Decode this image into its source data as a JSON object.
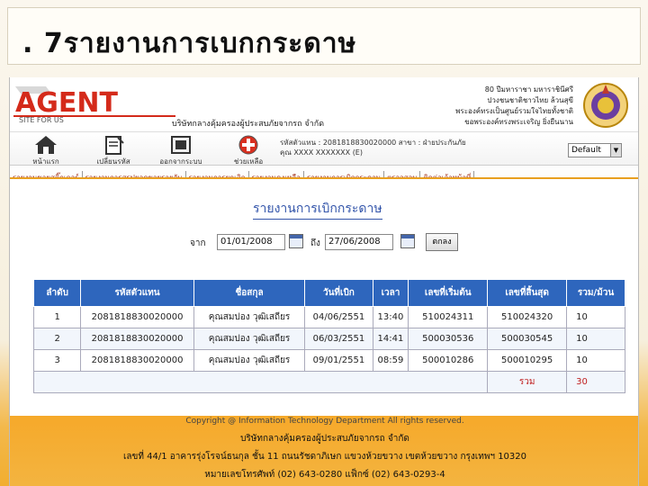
{
  "slide": {
    "title": ". 7รายงานการเบกกระดาษ"
  },
  "header": {
    "logo_text": "AGENT",
    "logo_subtext": "SITE FOR US",
    "company_name": "บริษัทกลางคุ้มครองผู้ประสบภัยจากรถ จำกัด",
    "royal_text": [
      "80 ปีมหาราชา มหาราชินีศรี",
      "ปวงชนชาติชาวไทย ล้วนสุขี",
      "พระองค์ทรงเป็นศูนย์รวมใจไทยทั้งชาติ",
      "ขอพระองค์ทรงพระเจริญ ยิ่งยืนนาน"
    ]
  },
  "toolbar": {
    "items": [
      {
        "label": "หน้าแรก",
        "icon": "home-icon"
      },
      {
        "label": "เปลี่ยนรหัส",
        "icon": "edit-icon"
      },
      {
        "label": "ออกจากระบบ",
        "icon": "logout-icon"
      },
      {
        "label": "ช่วยเหลือ",
        "icon": "help-icon"
      }
    ],
    "user_info": [
      "รหัสตัวแทน : 2081818830020000 สาขา : ฝ่ายประกันภัย",
      "คุณ XXXX XXXXXXX (E)"
    ],
    "style_select": "Default"
  },
  "nav": {
    "items": [
      "รายงานขายสติ๊กเกอร์",
      "รายงานการสรุปยอดขายรายวัน",
      "รายงานการยกเลิก",
      "รายงานคงเหลือ",
      "รายงานการเบิกกระดาษ",
      "ตรวจสอบ",
      "ติดต่อเจ้าหน้าที่"
    ]
  },
  "report": {
    "title": "รายงานการเบิกกระดาษ",
    "from_label": "จาก",
    "from_date": "01/01/2008",
    "to_label": "ถึง",
    "to_date": "27/06/2008",
    "ok_button": "ตกลง",
    "columns": [
      "ลำดับ",
      "รหัสตัวแทน",
      "ชื่อสกุล",
      "วันที่เบิก",
      "เวลา",
      "เลขที่เริ่มต้น",
      "เลขที่สิ้นสุด",
      "รวม/ม้วน"
    ],
    "rows": [
      [
        "1",
        "2081818830020000",
        "คุณสมปอง วุฒิเสถียร",
        "04/06/2551",
        "13:40",
        "510024311",
        "510024320",
        "10"
      ],
      [
        "2",
        "2081818830020000",
        "คุณสมปอง วุฒิเสถียร",
        "06/03/2551",
        "14:41",
        "500030536",
        "500030545",
        "10"
      ],
      [
        "3",
        "2081818830020000",
        "คุณสมปอง วุฒิเสถียร",
        "09/01/2551",
        "08:59",
        "500010286",
        "500010295",
        "10"
      ]
    ],
    "total_label": "รวม",
    "total_value": "30"
  },
  "footer": {
    "copyright": "Copyright @ Information Technology Department All rights reserved.",
    "company": "บริษัทกลางคุ้มครองผู้ประสบภัยจากรถ จำกัด",
    "address": "เลขที่ 44/1 อาคารรุ่งโรจน์ธนกุล ชั้น 11 ถนนรัชดาภิเษก แขวงห้วยขวาง เขตห้วยขวาง กรุงเทพฯ 10320",
    "phone": "หมายเลขโทรศัพท์ (02) 643-0280 แฟ็กซ์ (02) 643-0293-4"
  }
}
